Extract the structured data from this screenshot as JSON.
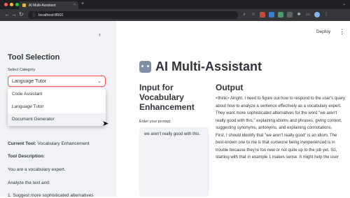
{
  "browser": {
    "tab_title": "AI Multi-Assistant",
    "tab_close": "×",
    "new_tab": "+",
    "url": "localhost:8501",
    "back": "←",
    "forward": "→",
    "reload": "↻",
    "menu_chevron": "⌄"
  },
  "sidebar": {
    "collapse_icon": "‹",
    "title": "Tool Selection",
    "select_label": "Select Category",
    "selected": "Language Tutor",
    "options": [
      "Code Assistant",
      "Language Tutor",
      "Document Generator"
    ],
    "current_tool_label": "Current Tool:",
    "current_tool_value": "Vocabulary Enhancement",
    "tool_description_label": "Tool Description:",
    "description_line1": "You are a vocabulary expert.",
    "description_line2": "Analyze the text and:",
    "description_item1": "1.   Suggest more sophisticated alternatives"
  },
  "header": {
    "deploy": "Deploy",
    "menu": "⋮"
  },
  "main": {
    "title": "AI Multi-Assistant",
    "input_title": "Input for Vocabulary Enhancement",
    "prompt_label": "Enter your prompt:",
    "prompt_value": "we aren't really good with this.",
    "output_title": "Output",
    "output_p1": "<think> Alright, I need to figure out how to respond to the user's query about how to analyze a sentence effectively as a vocabulary expert. They want more sophisticated alternatives for the word \"we aren't really good with this,\" explaining idioms and phrases, giving context, suggesting synonyms, antonyms, and explaining connotations.",
    "output_p2": "First, I should identify that \"we aren't really good\" is an idiom. The best-known one to me is that someone being inexperienced is in trouble because they're too new or not quite up to the job yet. So, starting with that in example 1 makes sense. It might help the user"
  }
}
